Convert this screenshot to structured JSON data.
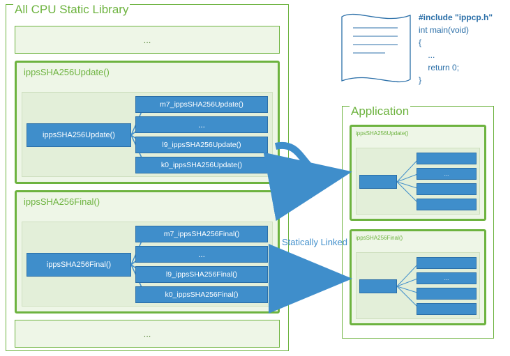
{
  "library": {
    "title": "All CPU Static Library",
    "ellipsis": "...",
    "update": {
      "title": "ippsSHA256Update()",
      "dispatch": "ippsSHA256Update()",
      "impls": [
        "m7_ippsSHA256Update()",
        "...",
        "l9_ippsSHA256Update()",
        "k0_ippsSHA256Update()"
      ]
    },
    "final": {
      "title": "ippsSHA256Final()",
      "dispatch": "ippsSHA256Final()",
      "impls": [
        "m7_ippsSHA256Final()",
        "...",
        "l9_ippsSHA256Final()",
        "k0_ippsSHA256Final()"
      ]
    }
  },
  "code": {
    "include": "#include \"ippcp.h\"",
    "l1": "int main(void)",
    "l2": "{",
    "l3": "    ...",
    "l4": "    return 0;",
    "l5": "}"
  },
  "link_label": "Statically Linked",
  "app": {
    "title": "Application",
    "mini1_title": "ippsSHA256Update()",
    "mini2_title": "ippsSHA256Final()",
    "impl_ellipsis": "..."
  }
}
